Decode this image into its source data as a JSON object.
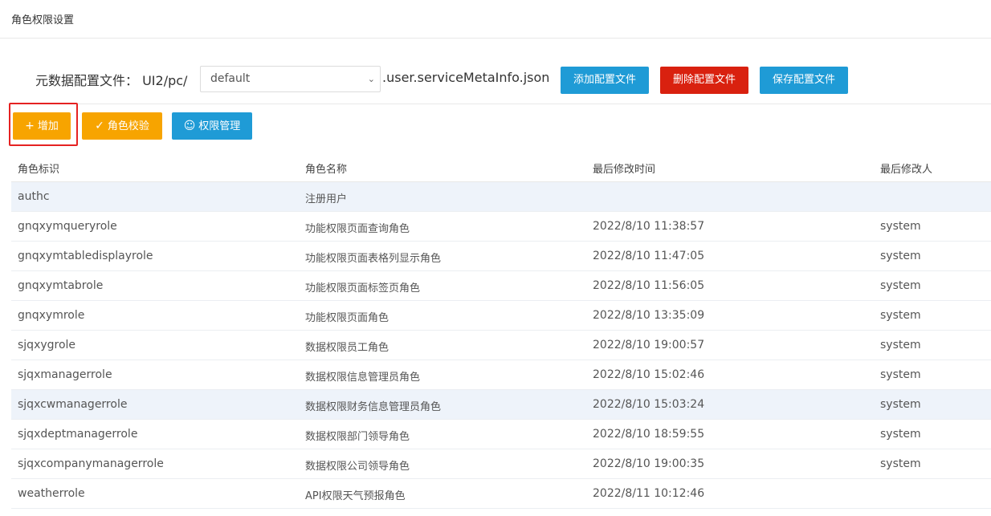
{
  "page": {
    "title": "角色权限设置"
  },
  "config": {
    "label": "元数据配置文件：  UI2/pc/",
    "select_value": "default",
    "suffix": ".user.serviceMetaInfo.json",
    "buttons": {
      "add": "添加配置文件",
      "delete": "删除配置文件",
      "save": "保存配置文件"
    }
  },
  "toolbar": {
    "add": "增加",
    "verify": "角色校验",
    "permission": "权限管理"
  },
  "table": {
    "headers": [
      "角色标识",
      "角色名称",
      "最后修改时间",
      "最后修改人"
    ],
    "rows": [
      {
        "id": "authc",
        "name": "注册用户",
        "time": "",
        "user": ""
      },
      {
        "id": "gnqxymqueryrole",
        "name": "功能权限页面查询角色",
        "time": "2022/8/10 11:38:57",
        "user": "system"
      },
      {
        "id": "gnqxymtabledisplayrole",
        "name": "功能权限页面表格列显示角色",
        "time": "2022/8/10 11:47:05",
        "user": "system"
      },
      {
        "id": "gnqxymtabrole",
        "name": "功能权限页面标签页角色",
        "time": "2022/8/10 11:56:05",
        "user": "system"
      },
      {
        "id": "gnqxymrole",
        "name": "功能权限页面角色",
        "time": "2022/8/10 13:35:09",
        "user": "system"
      },
      {
        "id": "sjqxygrole",
        "name": "数据权限员工角色",
        "time": "2022/8/10 19:00:57",
        "user": "system"
      },
      {
        "id": "sjqxmanagerrole",
        "name": "数据权限信息管理员角色",
        "time": "2022/8/10 15:02:46",
        "user": "system"
      },
      {
        "id": "sjqxcwmanagerrole",
        "name": "数据权限财务信息管理员角色",
        "time": "2022/8/10 15:03:24",
        "user": "system"
      },
      {
        "id": "sjqxdeptmanagerrole",
        "name": "数据权限部门领导角色",
        "time": "2022/8/10 18:59:55",
        "user": "system"
      },
      {
        "id": "sjqxcompanymanagerrole",
        "name": "数据权限公司领导角色",
        "time": "2022/8/10 19:00:35",
        "user": "system"
      },
      {
        "id": "weatherrole",
        "name": "API权限天气预报角色",
        "time": "2022/8/11 10:12:46",
        "user": ""
      }
    ]
  },
  "colors": {
    "blue": "#1f9bd6",
    "red": "#d9210f",
    "orange": "#f7a400",
    "highlight": "#e52222",
    "selected_row": "#eef3fa"
  }
}
